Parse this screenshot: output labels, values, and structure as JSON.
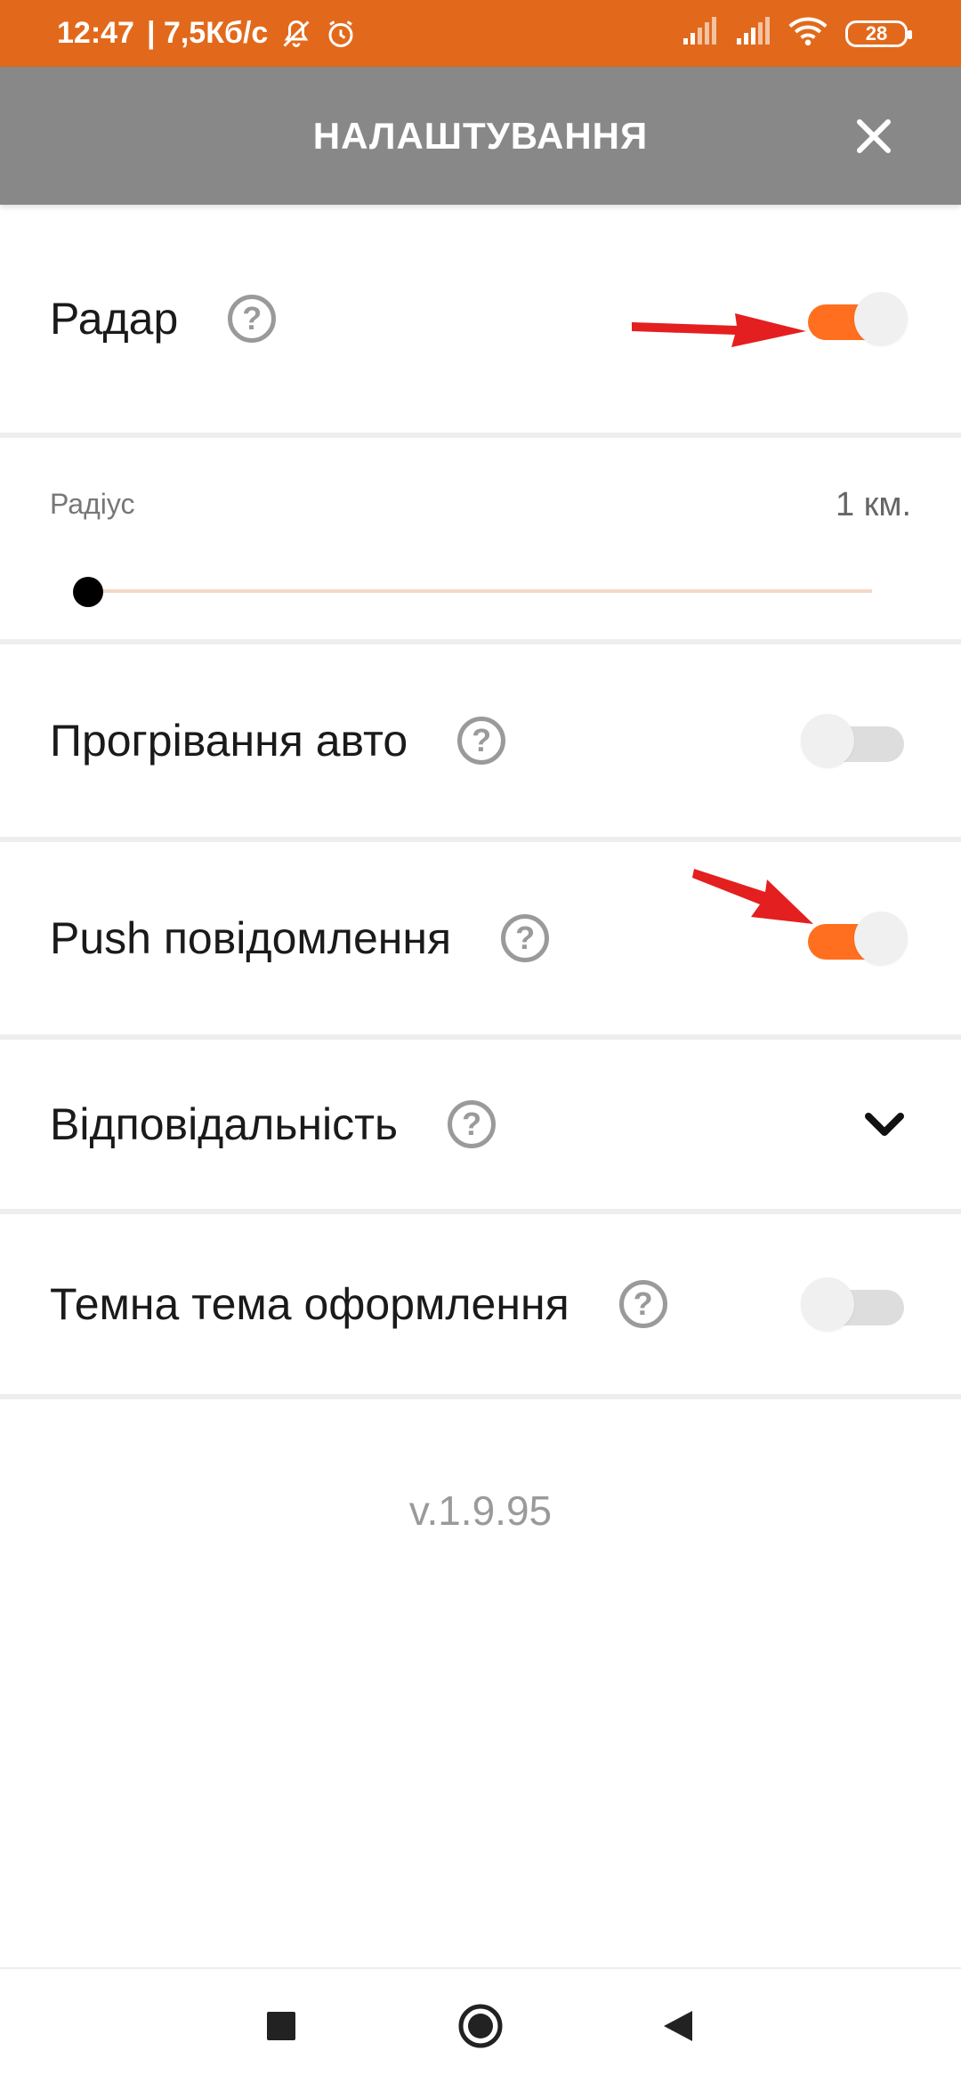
{
  "status_bar": {
    "time": "12:47",
    "speed": "| 7,5Кб/с",
    "battery": "28",
    "icons": [
      "mute-bell-icon",
      "alarm-icon",
      "signal-icon",
      "signal-icon",
      "wifi-icon",
      "battery-icon"
    ]
  },
  "header": {
    "title": "НАЛАШТУВАННЯ",
    "close_icon": "close-icon"
  },
  "settings": {
    "radar": {
      "label": "Радар",
      "help": "?",
      "enabled": true
    },
    "radius": {
      "label": "Радіус",
      "value": "1 км.",
      "slider_fraction": 0.0
    },
    "warmup": {
      "label": "Прогрівання авто",
      "help": "?",
      "enabled": false
    },
    "push": {
      "label": "Push повідомлення",
      "help": "?",
      "enabled": true
    },
    "responsibility": {
      "label": "Відповідальність",
      "help": "?",
      "icon": "chevron-down-icon"
    },
    "dark_theme": {
      "label": "Темна тема оформлення",
      "help": "?",
      "enabled": false
    }
  },
  "version": "v.1.9.95",
  "nav_bar": {
    "icons": [
      "recents-square-icon",
      "home-circle-icon",
      "back-triangle-icon"
    ]
  },
  "colors": {
    "status_bar": "#e2691b",
    "header": "#888888",
    "accent": "#ff6f1f",
    "arrow": "#e41f1f"
  }
}
